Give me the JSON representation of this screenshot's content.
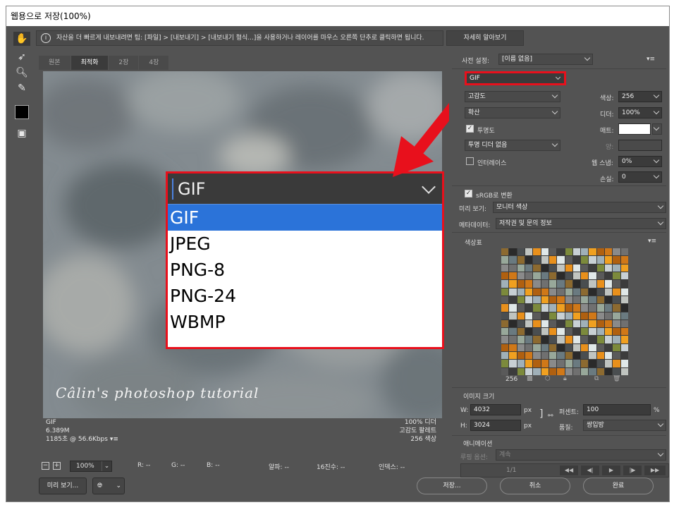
{
  "window": {
    "title": "웹용으로 저장(100%)"
  },
  "hint": {
    "icon": "info-icon",
    "text": "자산을 더 빠르게 내보내려면 팁: [파일] > [내보내기] > [내보내기 형식...]을 사용하거나 레이어를 마우스 오른쪽 단추로 클릭하면 됩니다.",
    "button": "자세히 알아보기"
  },
  "tools": [
    "hand-icon",
    "slice-select-icon",
    "zoom-icon",
    "eyedropper-icon",
    "color-swatch",
    "toggle-slices-icon"
  ],
  "tabs": [
    {
      "label": "원본"
    },
    {
      "label": "최적화"
    },
    {
      "label": "2장"
    },
    {
      "label": "4장"
    }
  ],
  "canvas": {
    "watermark": "Câlin's photoshop tutorial",
    "info_left": [
      "GIF",
      "6.389M",
      "1185초 @ 56.6Kbps"
    ],
    "info_right": [
      "100% 디더",
      "고감도 팔레트",
      "256 색상"
    ]
  },
  "dropdown": {
    "selected": "GIF",
    "options": [
      "GIF",
      "JPEG",
      "PNG-8",
      "PNG-24",
      "WBMP"
    ]
  },
  "statusbar": {
    "zoom": "100%",
    "r": "R: --",
    "g": "G: --",
    "b": "B: --",
    "alpha": "알파: --",
    "hex": "16진수: --",
    "index": "인덱스: --"
  },
  "bottom_buttons": {
    "preview": "미리 보기...",
    "save": "저장...",
    "cancel": "취소",
    "done": "완료"
  },
  "right_panel": {
    "preset_label": "사전 설정:",
    "preset_value": "[이름 없음]",
    "format": "GIF",
    "reduction": "고감도",
    "colors_label": "색상:",
    "colors_value": "256",
    "dither_algo": "확산",
    "dither_label": "디더:",
    "dither_value": "100%",
    "transparency_label": "투명도",
    "matte_label": "매트:",
    "transparency_dither": "투명 디더 없음",
    "amount_label": "양:",
    "interlace_label": "인터레이스",
    "websnap_label": "웹 스냅:",
    "websnap_value": "0%",
    "lossy_label": "손실:",
    "lossy_value": "0",
    "srgb_label": "sRGB로 변환",
    "preview_label": "미리 보기:",
    "preview_value": "모니터 색상",
    "metadata_label": "메타데이터:",
    "metadata_value": "저작권 및 문의 정보",
    "color_table_title": "색상표",
    "color_count": "256",
    "image_size_title": "이미지 크기",
    "w_label": "W:",
    "w_value": "4032",
    "h_label": "H:",
    "h_value": "3024",
    "px": "px",
    "percent_label": "퍼센트:",
    "percent_value": "100",
    "percent_unit": "%",
    "quality_label": "품질:",
    "quality_value": "쌍입방",
    "animation_title": "애니메이션",
    "loop_label": "루핑 옵션:",
    "loop_value": "계속",
    "frame_counter": "1/1"
  },
  "colors": {
    "accent_red": "#e8101c",
    "selection_blue": "#2b73d9"
  }
}
